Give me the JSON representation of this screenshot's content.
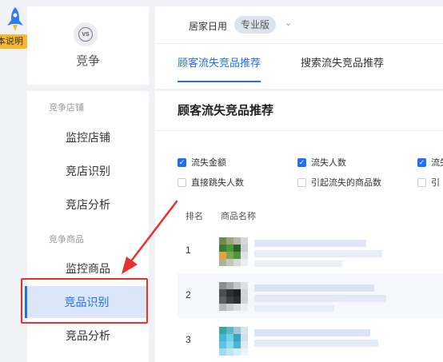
{
  "badge": {
    "label": "本说明"
  },
  "sidebar": {
    "title": "竞争",
    "icon_text": "VS",
    "sections": [
      {
        "label": "竞争店铺",
        "items": [
          "监控店铺",
          "竞店识别",
          "竞店分析"
        ]
      },
      {
        "label": "竞争商品",
        "items": [
          "监控商品",
          "竞品识别",
          "竞品分析"
        ]
      }
    ],
    "active_item": "竞品识别"
  },
  "header": {
    "shop_name": "居家日用",
    "edition": "专业版",
    "tabs": [
      "顾客流失竞品推荐",
      "搜索流失竞品推荐"
    ],
    "active_tab": 0
  },
  "card": {
    "title": "顾客流失竞品推荐",
    "checkboxes": [
      {
        "label": "流失金额",
        "checked": true
      },
      {
        "label": "流失人数",
        "checked": true
      },
      {
        "label": "流失",
        "checked": true
      },
      {
        "label": "直接跳失人数",
        "checked": false
      },
      {
        "label": "引起流失的商品数",
        "checked": false
      },
      {
        "label": "引",
        "checked": false
      }
    ],
    "columns": [
      "排名",
      "商品名称"
    ],
    "rows": [
      {
        "rank": "1"
      },
      {
        "rank": "2"
      },
      {
        "rank": "3"
      }
    ]
  },
  "colors": {
    "accent": "#1f6ff0",
    "highlight": "#e8302c",
    "badge": "#f7b733"
  }
}
